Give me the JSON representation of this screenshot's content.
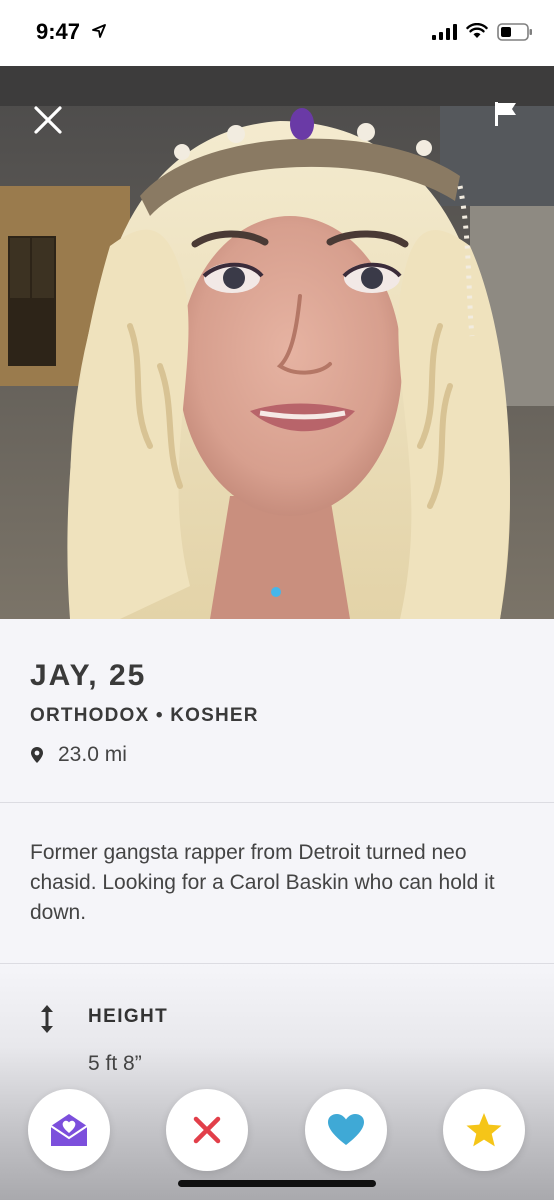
{
  "status_bar": {
    "time": "9:47",
    "icons": [
      "location-arrow-icon",
      "cellular-signal-icon",
      "wifi-icon",
      "battery-icon"
    ]
  },
  "photo": {
    "icons": [
      "close-icon",
      "flag-icon"
    ],
    "page_indicator": {
      "current": 1,
      "total": 1
    }
  },
  "profile": {
    "name_age": "JAY, 25",
    "tags": "ORTHODOX • KOSHER",
    "distance": "23.0 mi",
    "bio": "Former gangsta rapper from Detroit turned neo chasid. Looking for a Carol Baskin who can hold it down."
  },
  "details": {
    "height": {
      "label": "HEIGHT",
      "value": "5 ft 8”",
      "icon": "height-arrows-icon"
    }
  },
  "actions": [
    {
      "name": "message",
      "icon": "envelope-heart-icon",
      "color": "#7c4fdc"
    },
    {
      "name": "pass",
      "icon": "x-icon",
      "color": "#e23f4a"
    },
    {
      "name": "like",
      "icon": "heart-icon",
      "color": "#3fa9d6"
    },
    {
      "name": "super-like",
      "icon": "star-icon",
      "color": "#f5c518"
    }
  ],
  "colors": {
    "accent_blue": "#45b6ea",
    "background": "#f5f5f9"
  }
}
